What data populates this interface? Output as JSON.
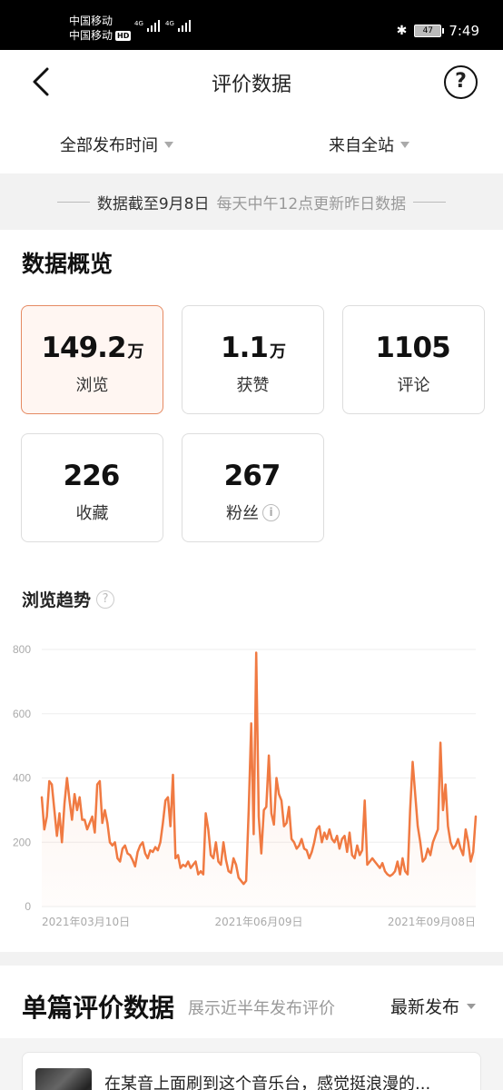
{
  "status_bar": {
    "carrier_1": "中国移动",
    "carrier_2": "中国移动",
    "hd_badge": "HD",
    "network_1": "4G",
    "network_2": "4G",
    "battery": "47",
    "time": "7:49"
  },
  "nav": {
    "title": "评价数据"
  },
  "filters": {
    "time": "全部发布时间",
    "source": "来自全站"
  },
  "notice": {
    "cutoff": "数据截至9月8日",
    "update": "每天中午12点更新昨日数据"
  },
  "overview": {
    "title": "数据概览",
    "stats": [
      {
        "value": "149.2",
        "unit": "万",
        "label": "浏览",
        "active": true
      },
      {
        "value": "1.1",
        "unit": "万",
        "label": "获赞",
        "active": false
      },
      {
        "value": "1105",
        "unit": "",
        "label": "评论",
        "active": false
      },
      {
        "value": "226",
        "unit": "",
        "label": "收藏",
        "active": false
      },
      {
        "value": "267",
        "unit": "",
        "label": "粉丝",
        "active": false
      }
    ],
    "info_icon": "i"
  },
  "trend": {
    "title": "浏览趋势",
    "help_icon": "?"
  },
  "chart_data": {
    "type": "area",
    "title": "",
    "xlabel": "",
    "ylabel": "",
    "ylim": [
      0,
      800
    ],
    "yticks": [
      0,
      200,
      400,
      600,
      800
    ],
    "x_ticks": [
      "2021年03月10日",
      "2021年06月09日",
      "2021年09月08日"
    ],
    "x_range": [
      "2021-03-10",
      "2021-09-08"
    ],
    "grid": true,
    "color": "#f07a42",
    "values": [
      340,
      240,
      280,
      390,
      380,
      300,
      220,
      290,
      200,
      320,
      400,
      330,
      270,
      350,
      300,
      340,
      270,
      270,
      240,
      260,
      280,
      230,
      380,
      390,
      260,
      300,
      260,
      200,
      190,
      200,
      150,
      140,
      180,
      190,
      165,
      160,
      145,
      125,
      170,
      190,
      200,
      165,
      150,
      175,
      170,
      185,
      175,
      200,
      260,
      330,
      340,
      250,
      410,
      150,
      160,
      120,
      130,
      125,
      140,
      120,
      130,
      140,
      100,
      110,
      100,
      290,
      240,
      160,
      150,
      200,
      140,
      130,
      200,
      145,
      110,
      105,
      150,
      130,
      90,
      80,
      70,
      80,
      300,
      570,
      225,
      790,
      280,
      165,
      300,
      310,
      470,
      290,
      255,
      400,
      350,
      330,
      250,
      260,
      310,
      210,
      200,
      180,
      190,
      210,
      180,
      175,
      150,
      170,
      200,
      240,
      250,
      200,
      230,
      210,
      240,
      210,
      200,
      220,
      180,
      210,
      220,
      170,
      230,
      160,
      150,
      190,
      160,
      175,
      330,
      130,
      140,
      150,
      140,
      130,
      120,
      135,
      110,
      100,
      95,
      100,
      110,
      140,
      100,
      150,
      110,
      100,
      300,
      450,
      350,
      250,
      200,
      140,
      150,
      180,
      160,
      200,
      220,
      240,
      510,
      300,
      380,
      250,
      200,
      180,
      190,
      210,
      180,
      160,
      240,
      200,
      140,
      170,
      280
    ]
  },
  "single_review": {
    "title": "单篇评价数据",
    "subtitle": "展示近半年发布评价",
    "sort_label": "最新发布",
    "first_item_text": "在某音上面刷到这个音乐台，感觉挺浪漫的..."
  }
}
